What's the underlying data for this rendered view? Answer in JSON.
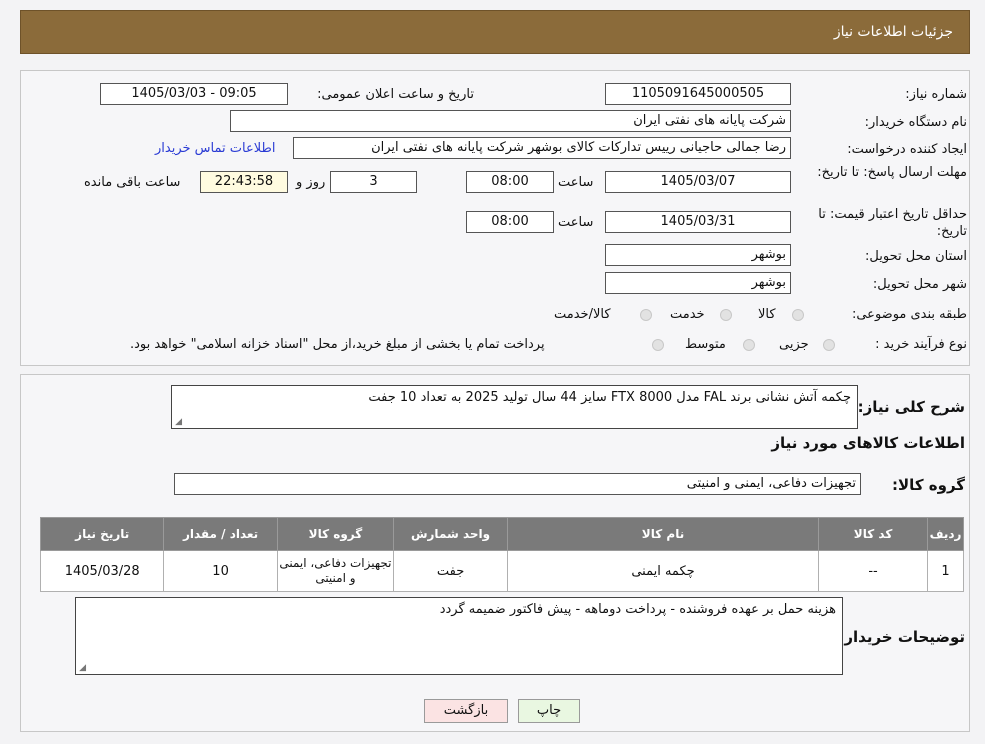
{
  "header": {
    "title": "جزئیات اطلاعات نیاز"
  },
  "form": {
    "need_number_label": "شماره نیاز:",
    "need_number": "1105091645000505",
    "announce_label": "تاریخ و ساعت اعلان عمومی:",
    "announce_value": "1405/03/03 - 09:05",
    "buyer_label": "نام دستگاه خریدار:",
    "buyer_value": "شرکت پایانه های نفتی ایران",
    "requester_label": "ایجاد کننده درخواست:",
    "requester_value": "رضا جمالی حاجیانی رییس تدارکات کالای بوشهر شرکت پایانه های نفتی ایران",
    "contact_link": "اطلاعات تماس خریدار",
    "deadline_label": "مهلت ارسال پاسخ: تا تاریخ:",
    "deadline_date": "1405/03/07",
    "time_label": "ساعت",
    "deadline_time": "08:00",
    "days_value": "3",
    "days_label": "روز و",
    "remaining_time": "22:43:58",
    "remaining_label": "ساعت باقی مانده",
    "validity_label": "حداقل تاریخ اعتبار قیمت: تا تاریخ:",
    "validity_date": "1405/03/31",
    "validity_time": "08:00",
    "province_label": "استان محل تحویل:",
    "province_value": "بوشهر",
    "city_label": "شهر محل تحویل:",
    "city_value": "بوشهر",
    "category_label": "طبقه بندی موضوعی:",
    "category_options": [
      "کالا",
      "خدمت",
      "کالا/خدمت"
    ],
    "process_label": "نوع فرآیند خرید :",
    "process_options": [
      "جزیی",
      "متوسط"
    ],
    "payment_note": "پرداخت تمام یا بخشی از مبلغ خرید،از محل \"اسناد خزانه اسلامی\" خواهد بود."
  },
  "details": {
    "description_label": "شرح کلی نیاز:",
    "description_value": "چکمه آتش نشانی برند FAL مدل FTX 8000 سایز 44 سال تولید 2025 به تعداد 10 جفت",
    "goods_info_title": "اطلاعات کالاهای مورد نیاز",
    "goods_group_label": "گروه کالا:",
    "goods_group_value": "تجهیزات دفاعی، ایمنی و امنیتی"
  },
  "table": {
    "headers": [
      "ردیف",
      "کد کالا",
      "نام کالا",
      "واحد شمارش",
      "گروه کالا",
      "تعداد / مقدار",
      "تاریخ نیاز"
    ],
    "rows": [
      [
        "1",
        "--",
        "چکمه ایمنی",
        "جفت",
        "تجهیزات دفاعی، ایمنی و امنیتی",
        "10",
        "1405/03/28"
      ]
    ]
  },
  "buyer_notes": {
    "label": "توضیحات خریدار:",
    "value": "هزینه حمل بر عهده فروشنده - پرداخت دوماهه - پیش فاکتور ضمیمه گردد"
  },
  "buttons": {
    "print": "چاپ",
    "back": "بازگشت"
  },
  "colors": {
    "header_bg": "#8b6b3a",
    "table_header_bg": "#7a7a7a",
    "print_bg": "#e9f7e1",
    "back_bg": "#fbe3e3"
  }
}
